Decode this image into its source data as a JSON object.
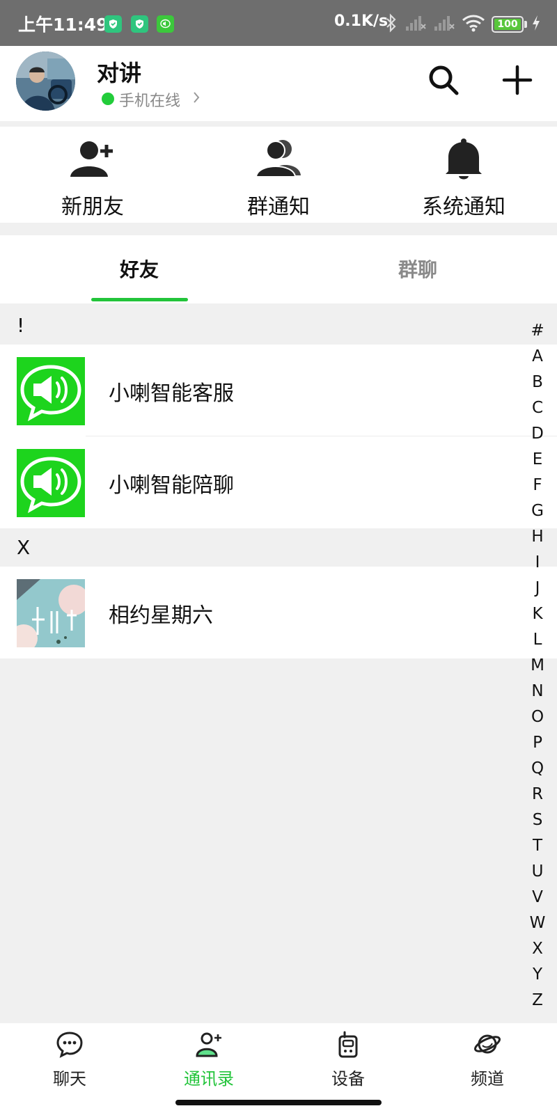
{
  "status_bar": {
    "time": "上午11:49",
    "network_speed": "0.1K/s",
    "battery": "100",
    "icons": [
      "shield-app-icon",
      "shield-app-icon",
      "speaker-app-icon",
      "bluetooth-icon",
      "signal-icon",
      "signal-icon",
      "wifi-icon",
      "battery-icon",
      "charging-icon"
    ]
  },
  "header": {
    "title": "对讲",
    "online_status": "手机在线",
    "icons": [
      "avatar",
      "search-icon",
      "plus-icon"
    ]
  },
  "quick_actions": [
    {
      "label": "新朋友",
      "icon": "add-person-icon"
    },
    {
      "label": "群通知",
      "icon": "group-icon"
    },
    {
      "label": "系统通知",
      "icon": "bell-icon"
    }
  ],
  "tabs": [
    {
      "label": "好友",
      "active": true
    },
    {
      "label": "群聊",
      "active": false
    }
  ],
  "sections": [
    {
      "header": "!",
      "items": [
        {
          "name": "小喇智能客服",
          "avatar": "speaker-chat-icon"
        },
        {
          "name": "小喇智能陪聊",
          "avatar": "speaker-chat-icon"
        }
      ]
    },
    {
      "header": "X",
      "items": [
        {
          "name": "相约星期六",
          "avatar": "photo-avatar"
        }
      ]
    }
  ],
  "alphabet_index": [
    "#",
    "A",
    "B",
    "C",
    "D",
    "E",
    "F",
    "G",
    "H",
    "I",
    "J",
    "K",
    "L",
    "M",
    "N",
    "O",
    "P",
    "Q",
    "R",
    "S",
    "T",
    "U",
    "V",
    "W",
    "X",
    "Y",
    "Z"
  ],
  "bottom_nav": [
    {
      "label": "聊天",
      "icon": "chat-icon",
      "active": false
    },
    {
      "label": "通讯录",
      "icon": "contacts-icon",
      "active": true
    },
    {
      "label": "设备",
      "icon": "walkie-talkie-icon",
      "active": false
    },
    {
      "label": "频道",
      "icon": "planet-icon",
      "active": false
    }
  ],
  "colors": {
    "accent": "#22c43a",
    "status_bar": "#6e6e6e",
    "background": "#f0f0f0",
    "avatar_green": "#1dd41d"
  }
}
